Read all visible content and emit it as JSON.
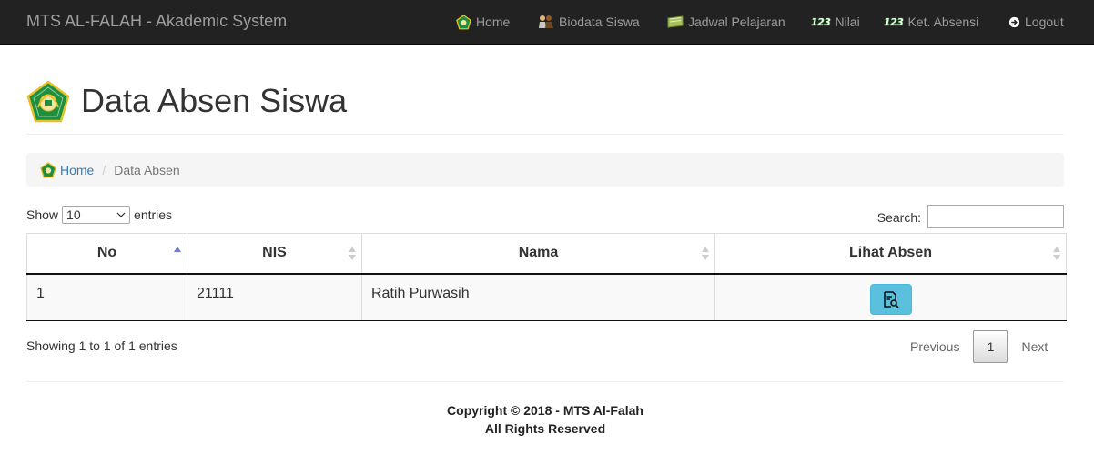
{
  "navbar": {
    "brand": "MTS AL-FALAH - Akademic System",
    "items": [
      {
        "label": "Home",
        "icon": "pentagon-logo-icon"
      },
      {
        "label": "Biodata Siswa",
        "icon": "students-icon"
      },
      {
        "label": "Jadwal Pelajaran",
        "icon": "book-icon"
      },
      {
        "label": "Nilai",
        "icon": "numbers-123-icon"
      },
      {
        "label": "Ket. Absensi",
        "icon": "numbers-123-icon"
      },
      {
        "label": "Logout",
        "icon": "logout-circle-icon"
      }
    ],
    "num_icon_text": "123"
  },
  "page": {
    "title": "Data Absen Siswa"
  },
  "breadcrumb": {
    "home": "Home",
    "separator": "/",
    "current": "Data Absen"
  },
  "table_controls": {
    "show_label": "Show",
    "entries_value": "10",
    "entries_label": "entries",
    "search_label": "Search:",
    "search_value": ""
  },
  "table": {
    "columns": [
      "No",
      "NIS",
      "Nama",
      "Lihat Absen"
    ],
    "rows": [
      {
        "no": "1",
        "nis": "21111",
        "nama": "Ratih Purwasih",
        "action_icon": "view-document-search-icon"
      }
    ]
  },
  "table_footer": {
    "info": "Showing 1 to 1 of 1 entries",
    "previous": "Previous",
    "current_page": "1",
    "next": "Next"
  },
  "footer": {
    "copyright": "Copyright © 2018 - MTS Al-Falah",
    "rights": "All Rights Reserved"
  },
  "colors": {
    "navbar_bg": "#222222",
    "nav_text": "#9d9d9d",
    "link": "#337ab7",
    "info_button": "#5bc0de",
    "logo_green": "#1f8e3e",
    "logo_gold": "#e7c02b"
  }
}
